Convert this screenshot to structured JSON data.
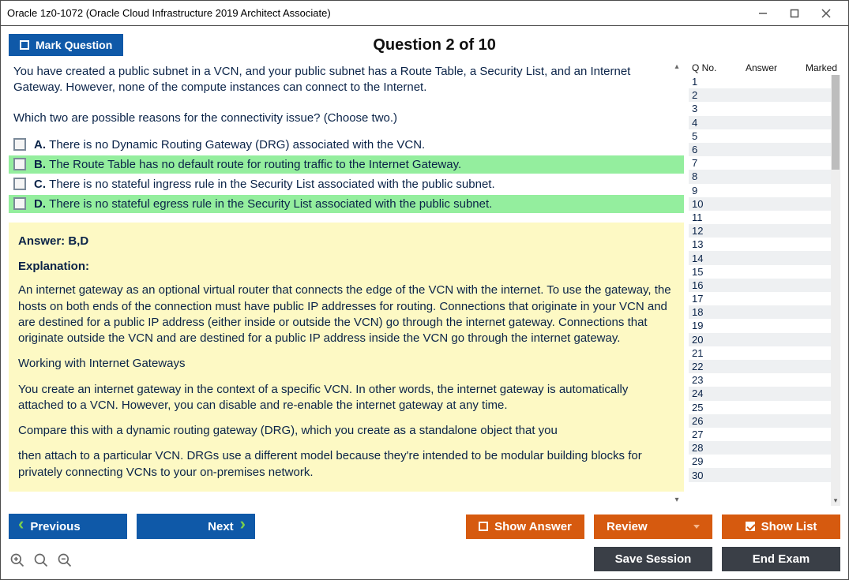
{
  "window": {
    "title": "Oracle 1z0-1072 (Oracle Cloud Infrastructure 2019 Architect Associate)"
  },
  "header": {
    "mark_label": "Mark Question",
    "question_counter": "Question 2 of 10"
  },
  "question": {
    "text_p1": "You have created a public subnet in a VCN, and your public subnet has a Route Table, a Security List, and an Internet Gateway. However, none of the compute instances can connect to the Internet.",
    "text_p2": "Which two are possible reasons for the connectivity issue? (Choose two.)",
    "choices": [
      {
        "letter": "A.",
        "text": "There is no Dynamic Routing Gateway (DRG) associated with the VCN.",
        "correct": false
      },
      {
        "letter": "B.",
        "text": "The Route Table has no default route for routing traffic to the Internet Gateway.",
        "correct": true
      },
      {
        "letter": "C.",
        "text": "There is no stateful ingress rule in the Security List associated with the public subnet.",
        "correct": false
      },
      {
        "letter": "D.",
        "text": "There is no stateful egress rule in the Security List associated with the public subnet.",
        "correct": true
      }
    ]
  },
  "explanation": {
    "answer_line": "Answer: B,D",
    "heading": "Explanation:",
    "p1": "An internet gateway as an optional virtual router that connects the edge of the VCN with the internet. To use the gateway, the hosts on both ends of the connection must have public IP addresses for routing. Connections that originate in your VCN and are destined for a public IP address (either inside or outside the VCN) go through the internet gateway. Connections that originate outside the VCN and are destined for a public IP address inside the VCN go through the internet gateway.",
    "p2": "Working with Internet Gateways",
    "p3": "You create an internet gateway in the context of a specific VCN. In other words, the internet gateway is automatically attached to a VCN. However, you can disable and re-enable the internet gateway at any time.",
    "p4": "Compare this with a dynamic routing gateway (DRG), which you create as a standalone object that you",
    "p5": "then attach to a particular VCN. DRGs use a different model because they're intended to be modular building blocks for privately connecting VCNs to your on-premises network."
  },
  "sidebar": {
    "col_qno": "Q No.",
    "col_answer": "Answer",
    "col_marked": "Marked",
    "rows": [
      1,
      2,
      3,
      4,
      5,
      6,
      7,
      8,
      9,
      10,
      11,
      12,
      13,
      14,
      15,
      16,
      17,
      18,
      19,
      20,
      21,
      22,
      23,
      24,
      25,
      26,
      27,
      28,
      29,
      30
    ]
  },
  "footer": {
    "previous": "Previous",
    "next": "Next",
    "show_answer": "Show Answer",
    "review": "Review",
    "show_list": "Show List",
    "save_session": "Save Session",
    "end_exam": "End Exam"
  }
}
